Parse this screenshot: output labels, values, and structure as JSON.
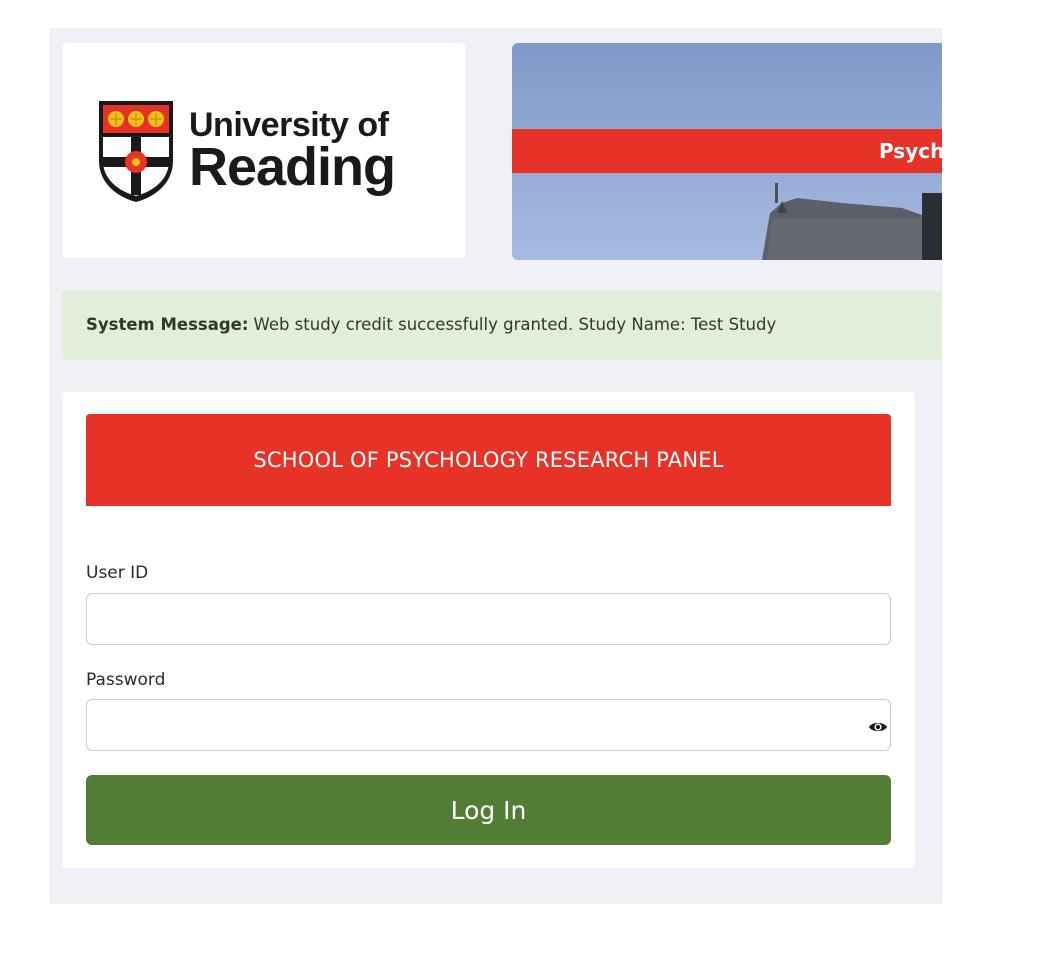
{
  "logo": {
    "line1": "University of",
    "line2": "Reading"
  },
  "banner": {
    "text": "Psych"
  },
  "system_message": {
    "label": "System Message:",
    "text": "Web study credit successfully granted. Study Name: Test Study"
  },
  "login": {
    "header": "SCHOOL OF PSYCHOLOGY RESEARCH PANEL",
    "user_id_label": "User ID",
    "user_id_value": "",
    "password_label": "Password",
    "password_value": "",
    "submit_label": "Log In"
  },
  "colors": {
    "brand_red": "#e63227",
    "button_green": "#527d35",
    "message_bg": "#e1eeda",
    "page_bg": "#f0f1f6"
  },
  "icons": {
    "show_password": "eye-icon",
    "logo": "university-shield-icon"
  }
}
